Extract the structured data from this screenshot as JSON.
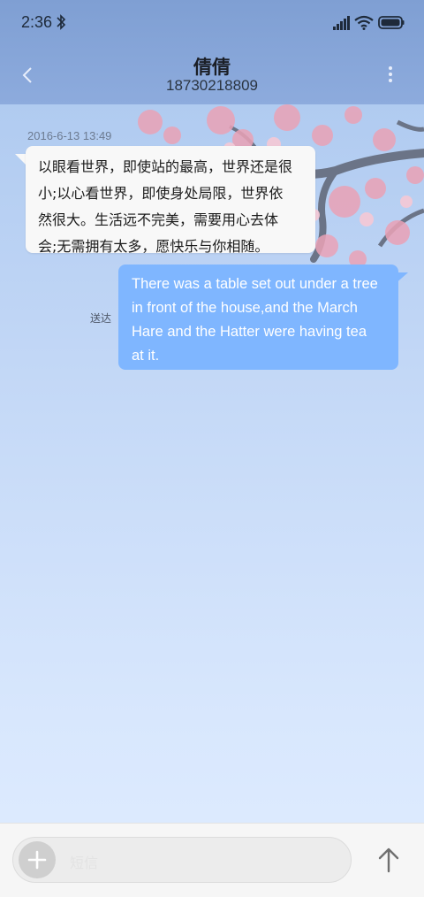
{
  "status_bar": {
    "time": "2:36",
    "icons": [
      "bluetooth-icon",
      "signal-icon",
      "wifi-icon",
      "battery-icon"
    ]
  },
  "header": {
    "title": "倩倩",
    "subtitle": "18730218809",
    "back_icon": "chevron-left-icon",
    "menu_icon": "more-vertical-icon"
  },
  "conversation": {
    "timestamp": "2016-6-13 13:49",
    "messages": [
      {
        "direction": "incoming",
        "lines": [
          "以眼看世界，即使站的最高，世界还是很",
          "小;以心看世界，即使身处局限，世界依",
          "然很大。生活远不完美，需要用心去体",
          "会;无需拥有太多，愿快乐与你相随。"
        ]
      },
      {
        "direction": "outgoing",
        "status": "送达",
        "lines": [
          "There was a table set out under a tree",
          "in front of the house,and the March",
          "Hare and the Hatter were having tea",
          "at it."
        ]
      }
    ]
  },
  "composer": {
    "placeholder": "短信",
    "add_icon": "plus-icon",
    "send_icon": "arrow-up-icon"
  },
  "colors": {
    "header_bg": "#8aa8da",
    "outgoing_bubble": "#7fb6ff",
    "incoming_bubble": "#f8f8f8"
  }
}
